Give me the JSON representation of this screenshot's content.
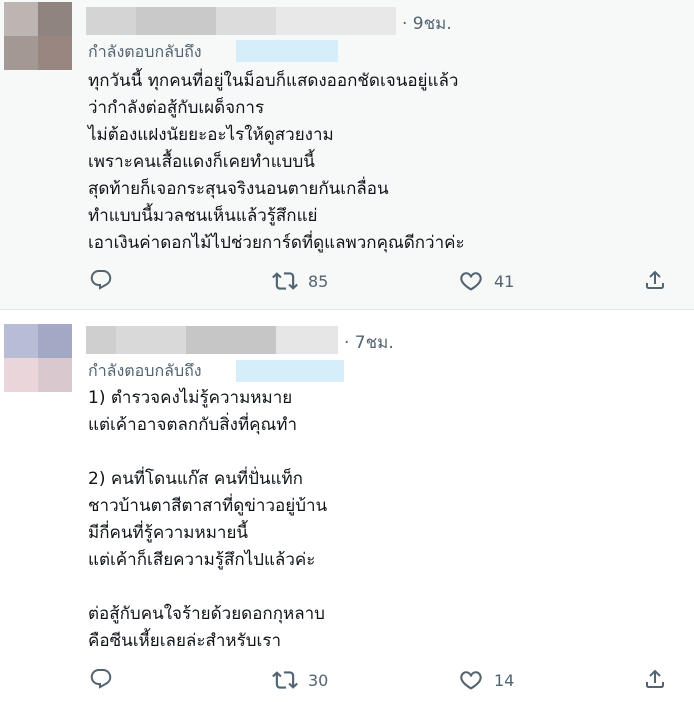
{
  "tweets": [
    {
      "time": "· 9ชม.",
      "replying_to_label": "กำลังตอบกลับถึง",
      "body": "ทุกวันนี้ ทุกคนที่อยู่ในม็อบก็แสดงออกชัดเจนอยู่แล้ว\nว่ากำลังต่อสู้กับเผด็จการ\nไม่ต้องแฝงนัยยะอะไรให้ดูสวยงาม\nเพราะคนเสื้อแดงก็เคยทำแบบนี้\nสุดท้ายก็เจอกระสุนจริงนอนตายกันเกลื่อน\nทำแบบนี้มวลชนเห็นแล้วรู้สึกแย่\nเอาเงินค่าดอกไม้ไปช่วยการ์ดที่ดูแลพวกคุณดีกว่าค่ะ",
      "retweet_count": "85",
      "like_count": "41",
      "avatar_colors": [
        "#bdb5b1",
        "#8f847f",
        "#a39893",
        "#9a8680"
      ]
    },
    {
      "time": "· 7ชม.",
      "replying_to_label": "กำลังตอบกลับถึง",
      "body": "1) ตำรวจคงไม่รู้ความหมาย\nแต่เค้าอาจตลกกับสิ่งที่คุณทำ\n\n2) คนที่โดนแก๊ส คนที่ปั่นแท็ก\nชาวบ้านตาสีตาสาที่ดูข่าวอยู่บ้าน\nมีกี่คนที่รู้ความหมายนี้\nแต่เค้าก็เสียความรู้สึกไปแล้วค่ะ\n\nต่อสู้กับคนใจร้ายด้วยดอกกุหลาบ\nคือซีนเหี้ยเลยล่ะสำหรับเรา",
      "retweet_count": "30",
      "like_count": "14",
      "avatar_colors": [
        "#b7bdd4",
        "#a3a8c4",
        "#ead6da",
        "#d9c9ce"
      ]
    }
  ],
  "icons": {
    "reply": "reply-icon",
    "retweet": "retweet-icon",
    "like": "heart-icon",
    "share": "share-icon"
  },
  "colors": {
    "secondary_text": "#536471",
    "highlight_background": "#f7f9f9",
    "mention_blur": "#d6eefa"
  }
}
